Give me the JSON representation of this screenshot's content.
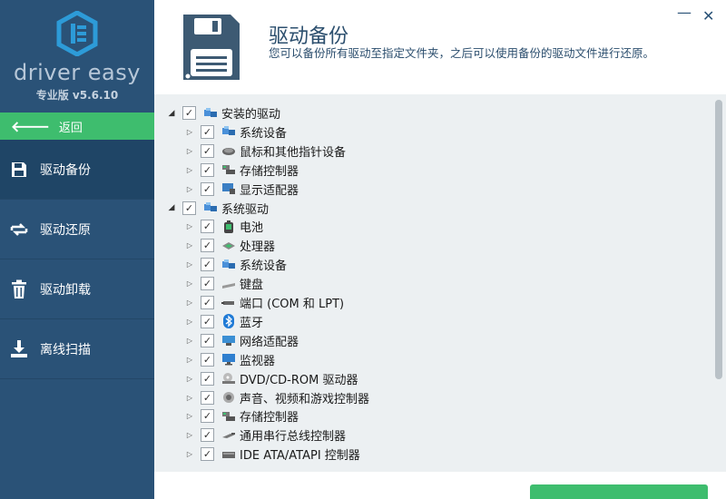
{
  "sidebar": {
    "brand": "driver easy",
    "edition": "专业版 v5.6.10",
    "back_label": "返回",
    "items": [
      {
        "label": "驱动备份",
        "icon": "floppy-icon",
        "active": true
      },
      {
        "label": "驱动还原",
        "icon": "restore-icon",
        "active": false
      },
      {
        "label": "驱动卸载",
        "icon": "trash-icon",
        "active": false
      },
      {
        "label": "离线扫描",
        "icon": "download-icon",
        "active": false
      }
    ]
  },
  "header": {
    "title": "驱动备份",
    "subtitle": "您可以备份所有驱动至指定文件夹，之后可以使用备份的驱动文件进行还原。"
  },
  "tree": {
    "rows": [
      {
        "label": "安装的驱动",
        "level": 0,
        "expanded": true,
        "icon": "device-icon"
      },
      {
        "label": "系统设备",
        "level": 1,
        "expanded": false,
        "icon": "device-icon"
      },
      {
        "label": "鼠标和其他指针设备",
        "level": 1,
        "expanded": false,
        "icon": "mouse-icon"
      },
      {
        "label": "存储控制器",
        "level": 1,
        "expanded": false,
        "icon": "storage-icon"
      },
      {
        "label": "显示适配器",
        "level": 1,
        "expanded": false,
        "icon": "display-icon"
      },
      {
        "label": "系统驱动",
        "level": 0,
        "expanded": true,
        "icon": "device-icon"
      },
      {
        "label": "电池",
        "level": 1,
        "expanded": false,
        "icon": "battery-icon"
      },
      {
        "label": "处理器",
        "level": 1,
        "expanded": false,
        "icon": "processor-icon"
      },
      {
        "label": "系统设备",
        "level": 1,
        "expanded": false,
        "icon": "device-icon"
      },
      {
        "label": "键盘",
        "level": 1,
        "expanded": false,
        "icon": "keyboard-icon"
      },
      {
        "label": "端口 (COM 和 LPT)",
        "level": 1,
        "expanded": false,
        "icon": "port-icon"
      },
      {
        "label": "蓝牙",
        "level": 1,
        "expanded": false,
        "icon": "bluetooth-icon"
      },
      {
        "label": "网络适配器",
        "level": 1,
        "expanded": false,
        "icon": "network-icon"
      },
      {
        "label": "监视器",
        "level": 1,
        "expanded": false,
        "icon": "monitor-icon"
      },
      {
        "label": "DVD/CD-ROM 驱动器",
        "level": 1,
        "expanded": false,
        "icon": "disc-icon"
      },
      {
        "label": "声音、视频和游戏控制器",
        "level": 1,
        "expanded": false,
        "icon": "sound-icon"
      },
      {
        "label": "存储控制器",
        "level": 1,
        "expanded": false,
        "icon": "storage-icon"
      },
      {
        "label": "通用串行总线控制器",
        "level": 1,
        "expanded": false,
        "icon": "usb-icon"
      },
      {
        "label": "IDE ATA/ATAPI 控制器",
        "level": 1,
        "expanded": false,
        "icon": "ide-icon"
      }
    ]
  },
  "colors": {
    "sidebar": "#2a5277",
    "accent_green": "#3ebd6e",
    "tree_bg": "#ecf0f2"
  }
}
